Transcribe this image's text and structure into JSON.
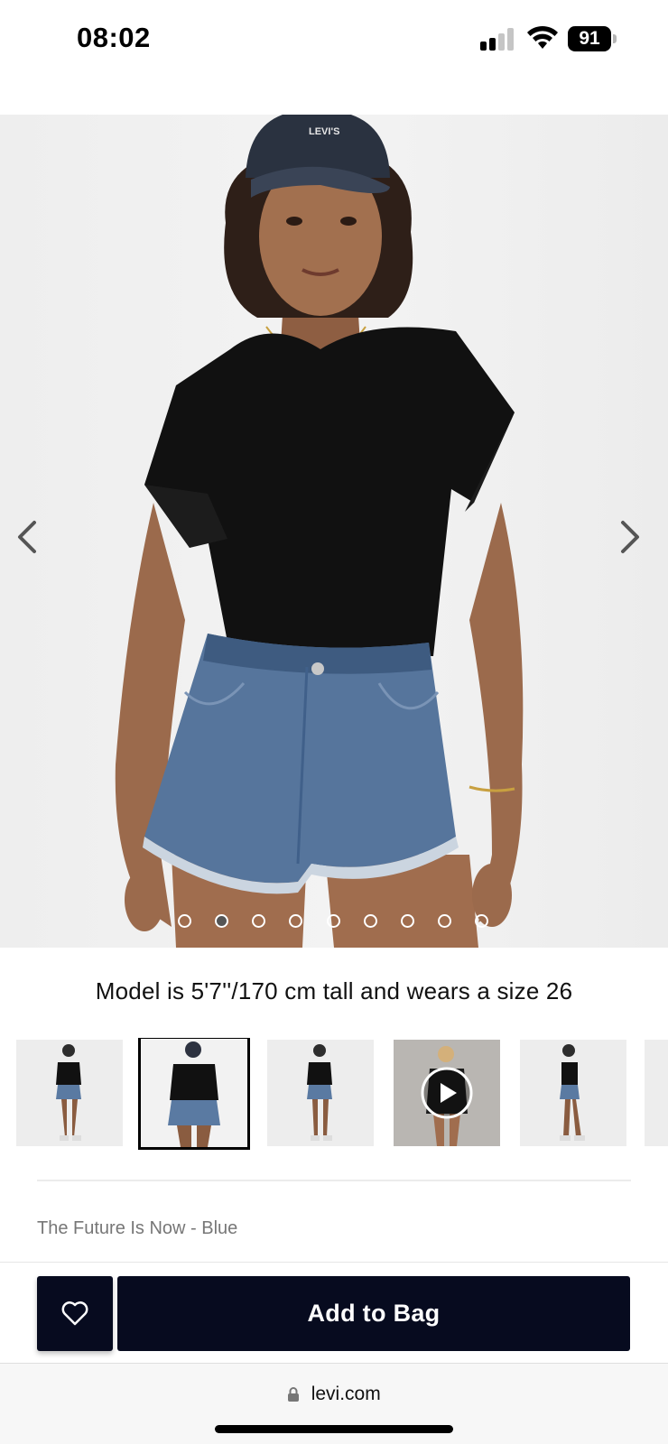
{
  "status": {
    "time": "08:02",
    "battery": "91"
  },
  "gallery": {
    "total_images": 9,
    "active_index": 1,
    "caption": "Model is 5'7''/170 cm tall and wears a size 26",
    "thumbnails": [
      {
        "type": "image",
        "selected": false
      },
      {
        "type": "image",
        "selected": true
      },
      {
        "type": "image",
        "selected": false
      },
      {
        "type": "video",
        "selected": false
      },
      {
        "type": "image",
        "selected": false
      }
    ]
  },
  "product": {
    "name": "The Future Is Now - Blue"
  },
  "actions": {
    "add_to_bag_label": "Add to Bag",
    "wishlist_icon": "heart-icon"
  },
  "browser": {
    "url": "levi.com"
  },
  "colors": {
    "primary_button": "#070b1f",
    "hero_background": "#efefef"
  }
}
